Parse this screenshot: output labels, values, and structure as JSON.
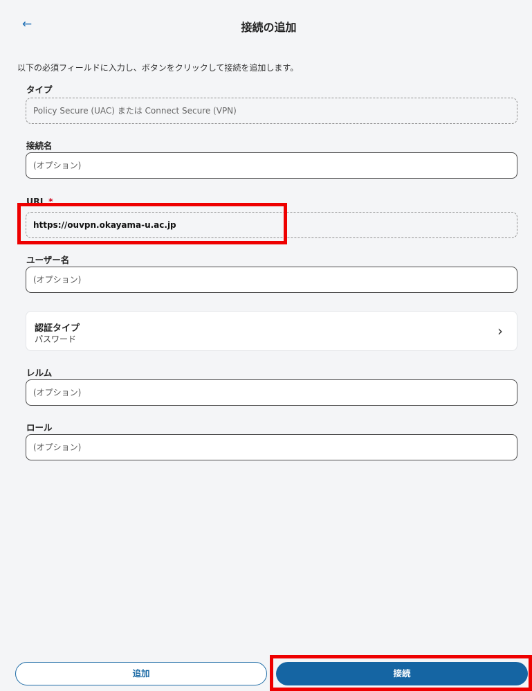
{
  "header": {
    "back_icon": "←",
    "title": "接続の追加"
  },
  "intro": "以下の必須フィールドに入力し、ボタンをクリックして接続を追加します。",
  "fields": {
    "type": {
      "label": "タイプ",
      "value": "Policy Secure (UAC) または Connect Secure (VPN)"
    },
    "connection_name": {
      "label": "接続名",
      "placeholder": "(オプション)"
    },
    "url": {
      "label": "URL",
      "required_mark": "*",
      "value": "https://ouvpn.okayama-u.ac.jp"
    },
    "username": {
      "label": "ユーザー名",
      "placeholder": "(オプション)"
    },
    "auth_type": {
      "label": "認証タイプ",
      "value": "パスワード",
      "chevron": "›"
    },
    "realm": {
      "label": "レルム",
      "placeholder": "(オプション)"
    },
    "role": {
      "label": "ロール",
      "placeholder": "(オプション)"
    }
  },
  "buttons": {
    "add": "追加",
    "connect": "接続"
  },
  "colors": {
    "accent": "#1565a3",
    "highlight": "#ee0000",
    "required": "#d0021b"
  }
}
